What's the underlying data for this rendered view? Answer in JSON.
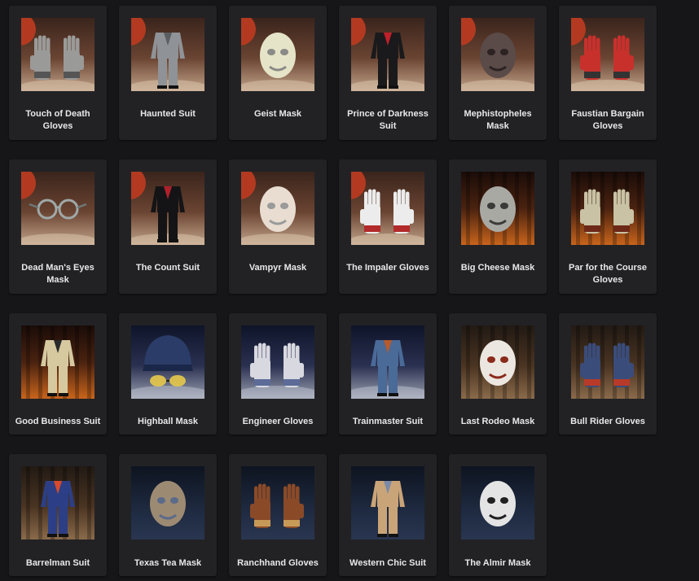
{
  "items": [
    {
      "label": "Touch of Death Gloves",
      "icon": "gloves-icon",
      "theme": "halloween",
      "color": "#9a9a98",
      "accent": "#555"
    },
    {
      "label": "Haunted Suit",
      "icon": "suit-icon",
      "theme": "halloween",
      "color": "#8f9296",
      "accent": "#5a5d61"
    },
    {
      "label": "Geist Mask",
      "icon": "mask-icon",
      "theme": "halloween",
      "color": "#e6e4c8",
      "accent": "#8a8a86"
    },
    {
      "label": "Prince of Darkness Suit",
      "icon": "suit-icon",
      "theme": "halloween",
      "color": "#1a1a1c",
      "accent": "#c0202a"
    },
    {
      "label": "Mephistopheles Mask",
      "icon": "mask-icon",
      "theme": "halloween",
      "color": "#5a4a48",
      "accent": "#2b2221"
    },
    {
      "label": "Faustian Bargain Gloves",
      "icon": "gloves-icon",
      "theme": "halloween",
      "color": "#c8302c",
      "accent": "#333"
    },
    {
      "label": "Dead Man's Eyes Mask",
      "icon": "glasses-icon",
      "theme": "halloween",
      "color": "#9fa8a8",
      "accent": "#6d7878"
    },
    {
      "label": "The Count Suit",
      "icon": "suit-icon",
      "theme": "halloween",
      "color": "#141416",
      "accent": "#b0202a"
    },
    {
      "label": "Vampyr Mask",
      "icon": "mask-icon",
      "theme": "halloween",
      "color": "#e8ddd0",
      "accent": "#9a9a9a"
    },
    {
      "label": "The Impaler Gloves",
      "icon": "gloves-icon",
      "theme": "halloween",
      "color": "#ececec",
      "accent": "#b32a2a"
    },
    {
      "label": "Big Cheese Mask",
      "icon": "mask-icon",
      "theme": "fire",
      "color": "#a9a9a4",
      "accent": "#3a3a38"
    },
    {
      "label": "Par for the Course Gloves",
      "icon": "gloves-icon",
      "theme": "fire",
      "color": "#c9c2a5",
      "accent": "#6d2818"
    },
    {
      "label": "Good Business Suit",
      "icon": "suit-icon",
      "theme": "fire",
      "color": "#d6c9a0",
      "accent": "#2a2a2a"
    },
    {
      "label": "Highball Mask",
      "icon": "cap-icon",
      "theme": "smoke",
      "color": "#2b3c68",
      "accent": "#e7c94a"
    },
    {
      "label": "Engineer Gloves",
      "icon": "gloves-icon",
      "theme": "smoke",
      "color": "#d8d8e0",
      "accent": "#5c6b98"
    },
    {
      "label": "Trainmaster Suit",
      "icon": "suit-icon",
      "theme": "smoke",
      "color": "#4a6a98",
      "accent": "#b85a2a"
    },
    {
      "label": "Last Rodeo Mask",
      "icon": "mask-icon",
      "theme": "barn",
      "color": "#ece6e0",
      "accent": "#8a2a1a"
    },
    {
      "label": "Bull Rider Gloves",
      "icon": "gloves-icon",
      "theme": "barn",
      "color": "#3a4c7a",
      "accent": "#b83a28"
    },
    {
      "label": "Barrelman Suit",
      "icon": "suit-icon",
      "theme": "barn",
      "color": "#2c3f86",
      "accent": "#d84a2a"
    },
    {
      "label": "Texas Tea Mask",
      "icon": "mask-icon",
      "theme": "night",
      "color": "#9c8a72",
      "accent": "#5c6a8a"
    },
    {
      "label": "Ranchhand Gloves",
      "icon": "gloves-icon",
      "theme": "night",
      "color": "#8a4a28",
      "accent": "#c89a58"
    },
    {
      "label": "Western Chic Suit",
      "icon": "suit-icon",
      "theme": "night",
      "color": "#c9a478",
      "accent": "#7a8aa8"
    },
    {
      "label": "The Almir Mask",
      "icon": "mask-icon",
      "theme": "night",
      "color": "#e4e4e4",
      "accent": "#202020"
    }
  ],
  "colors": {
    "page_bg": "#161618",
    "card_bg": "#222225",
    "text": "#e8e8ea",
    "moon": "#b33a20"
  }
}
